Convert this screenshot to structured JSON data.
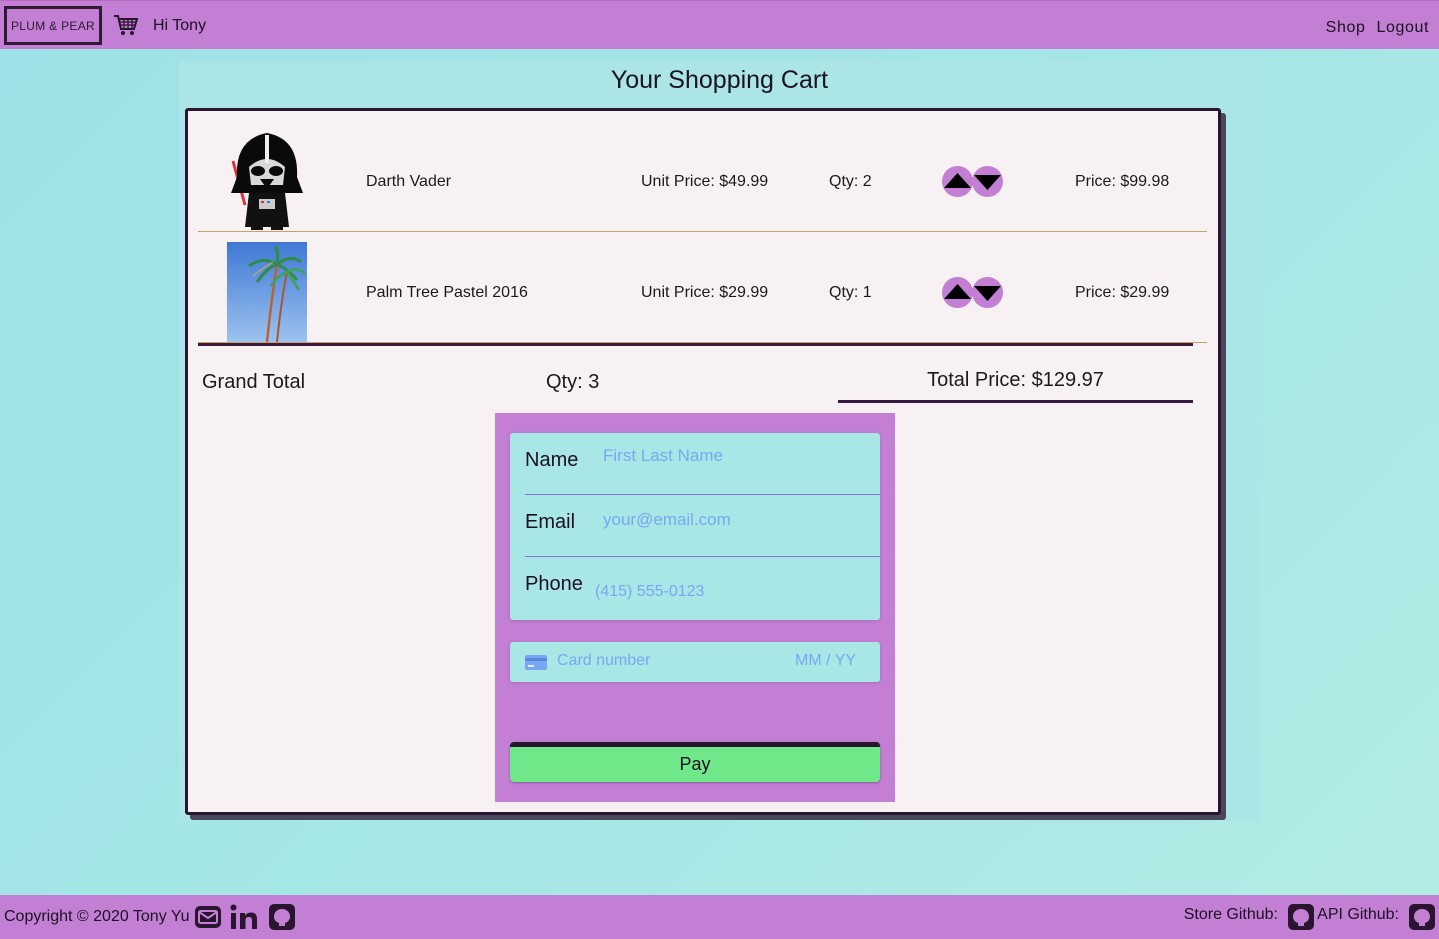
{
  "header": {
    "brand": "PLUM & PEAR",
    "greeting": "Hi Tony",
    "nav": [
      "Shop",
      "Logout"
    ]
  },
  "page": {
    "title": "Your Shopping Cart"
  },
  "cart": {
    "items": [
      {
        "name": "Darth Vader",
        "unit_price": "Unit Price: $49.99",
        "qty": "Qty: 2",
        "price": "Price: $99.98"
      },
      {
        "name": "Palm Tree Pastel 2016",
        "unit_price": "Unit Price: $29.99",
        "qty": "Qty: 1",
        "price": "Price: $29.99"
      }
    ],
    "grand_total_label": "Grand Total",
    "total_qty": "Qty: 3",
    "total_price": "Total Price: $129.97"
  },
  "checkout": {
    "name_label": "Name",
    "name_placeholder": "First Last Name",
    "email_label": "Email",
    "email_placeholder": "your@email.com",
    "phone_label": "Phone",
    "phone_placeholder": "(415) 555-0123",
    "card_placeholder": "Card number",
    "expiry_placeholder": "MM / YY",
    "pay_label": "Pay"
  },
  "footer": {
    "copyright": "Copyright © 2020 Tony Yu",
    "store_github": "Store Github:",
    "api_github": "API Github:"
  },
  "colors": {
    "accent": "#c27fd3",
    "background": "#a6e6e6",
    "card": "#f7f1f3",
    "pay_button": "#6ee889",
    "dark": "#2a1530",
    "placeholder": "#7aa7f4"
  },
  "icons": [
    "cart-icon",
    "caret-up-icon",
    "caret-down-icon",
    "credit-card-icon",
    "envelope-icon",
    "linkedin-icon",
    "github-icon"
  ]
}
